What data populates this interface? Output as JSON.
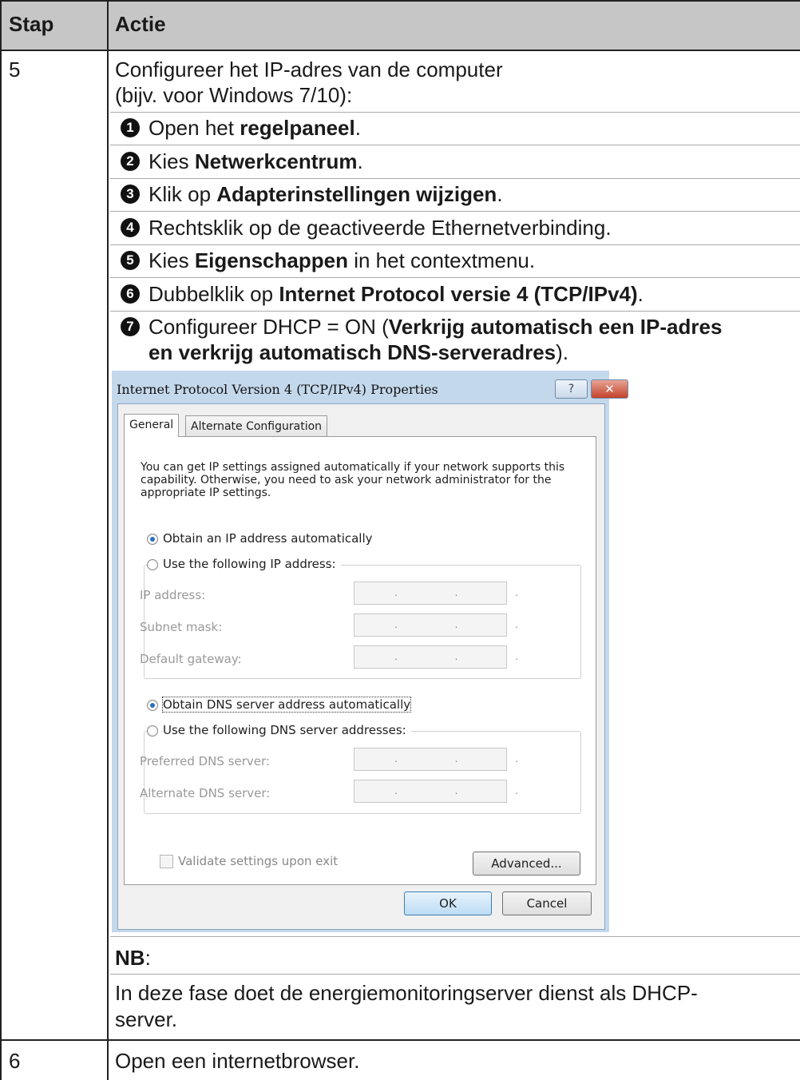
{
  "table": {
    "header": {
      "step": "Stap",
      "action": "Actie"
    },
    "rows": [
      {
        "step": "5",
        "intro_line1": "Configureer het IP-adres van de computer",
        "intro_line2": "(bijv. voor Windows 7/10):",
        "items": [
          {
            "bullet": "1",
            "pre": "Open het ",
            "bold": "regelpaneel",
            "post": "."
          },
          {
            "bullet": "2",
            "pre": "Kies ",
            "bold": "Netwerkcentrum",
            "post": "."
          },
          {
            "bullet": "3",
            "pre": "Klik op ",
            "bold": "Adapterinstellingen wijzigen",
            "post": "."
          },
          {
            "bullet": "4",
            "pre": "Rechtsklik op de geactiveerde Ethernetverbinding.",
            "bold": "",
            "post": ""
          },
          {
            "bullet": "5",
            "pre": "Kies ",
            "bold": "Eigenschappen",
            "post": " in het contextmenu."
          },
          {
            "bullet": "6",
            "pre": "Dubbelklik op ",
            "bold": "Internet Protocol versie 4 (TCP/IPv4)",
            "post": "."
          },
          {
            "bullet": "7",
            "pre": "Configureer DHCP = ON (",
            "bold": "Verkrijg automatisch een IP-adres",
            "bold2": "en verkrijg automatisch DNS-serveradres",
            "post": ")."
          }
        ],
        "note_label": "NB",
        "note_colon": ":",
        "note_line1": "In deze fase doet de energiemonitoringserver dienst als DHCP-",
        "note_line2": "server."
      },
      {
        "step": "6",
        "text": "Open een internetbrowser."
      }
    ]
  },
  "dialog": {
    "title": "Internet Protocol Version 4 (TCP/IPv4) Properties",
    "help_label": "?",
    "close_label": "✕",
    "tabs": [
      "General",
      "Alternate Configuration"
    ],
    "description": "You can get IP settings assigned automatically if your network supports this capability. Otherwise, you need to ask your network administrator for the appropriate IP settings.",
    "obtain_ip": "Obtain an IP address automatically",
    "use_ip": "Use the following IP address:",
    "ip_fields": [
      "IP address:",
      "Subnet mask:",
      "Default gateway:"
    ],
    "obtain_dns": "Obtain DNS server address automatically",
    "use_dns": "Use the following DNS server addresses:",
    "dns_fields": [
      "Preferred DNS server:",
      "Alternate DNS server:"
    ],
    "ip_placeholder": ". . .",
    "validate": "Validate settings upon exit",
    "advanced": "Advanced...",
    "ok": "OK",
    "cancel": "Cancel"
  }
}
